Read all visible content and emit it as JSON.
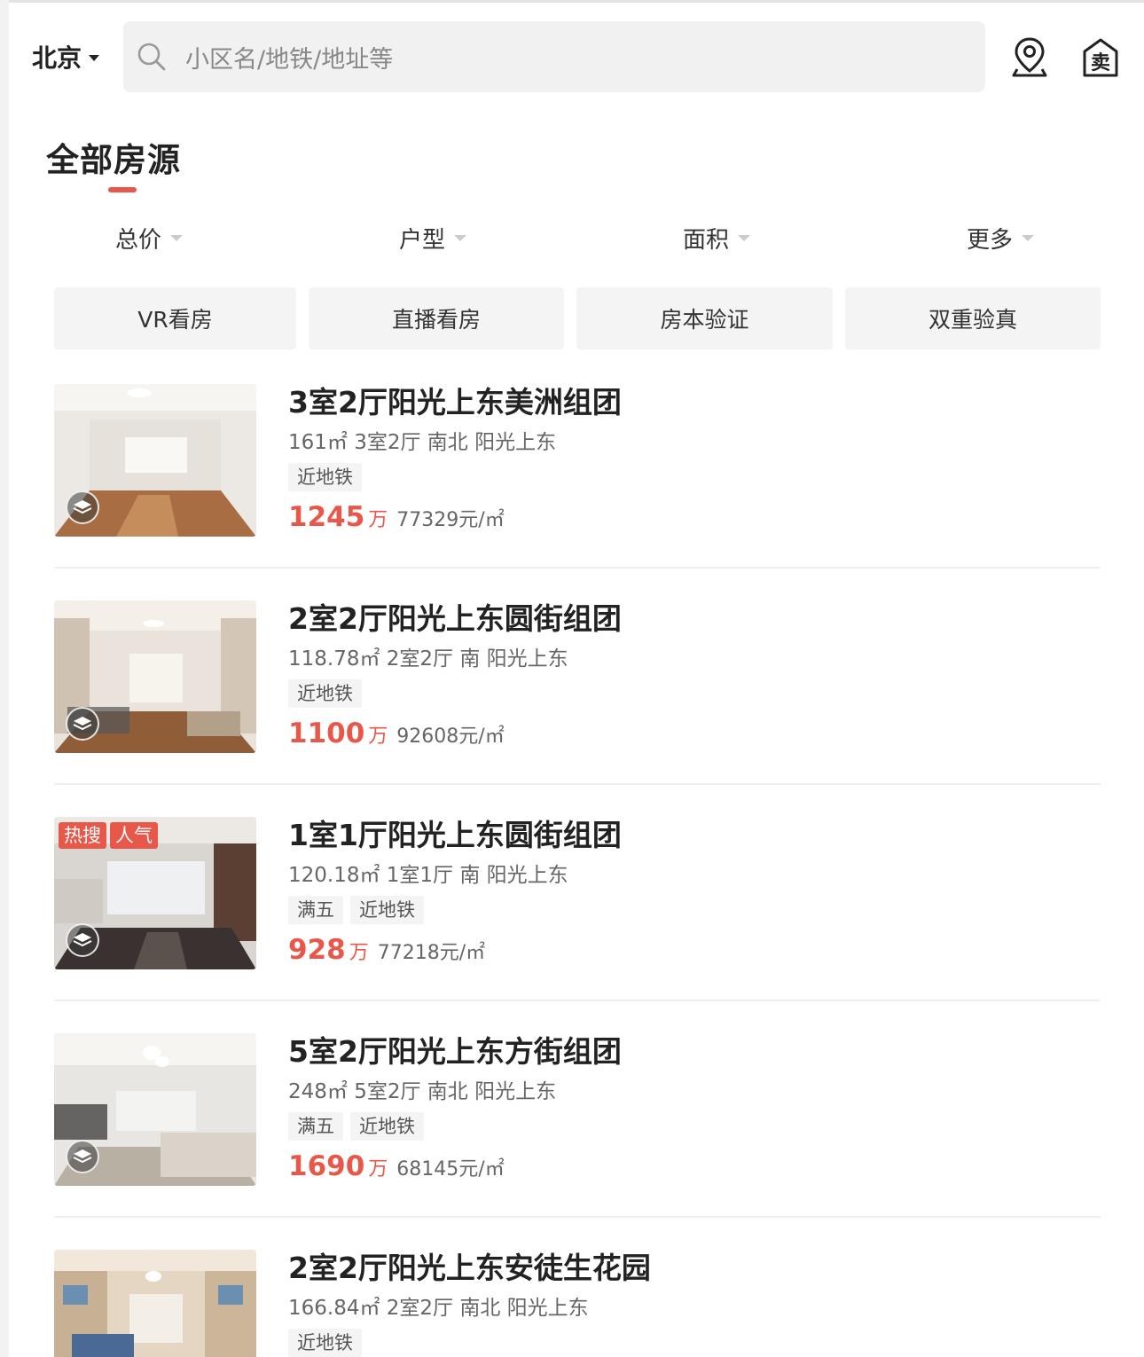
{
  "header": {
    "city": "北京",
    "search_placeholder": "小区名/地铁/地址等",
    "sell_label": "卖"
  },
  "section_title": "全部房源",
  "filters": [
    "总价",
    "户型",
    "面积",
    "更多"
  ],
  "quick_tags": [
    "VR看房",
    "直播看房",
    "房本验证",
    "双重验真"
  ],
  "price_unit": "万",
  "listings": [
    {
      "title": "3室2厅阳光上东美洲组团",
      "meta": "161㎡ 3室2厅 南北 阳光上东",
      "tags": [
        "近地铁"
      ],
      "hot_tags": [],
      "total": "1245",
      "per_sqm": "77329元/㎡"
    },
    {
      "title": "2室2厅阳光上东圆街组团",
      "meta": "118.78㎡ 2室2厅 南 阳光上东",
      "tags": [
        "近地铁"
      ],
      "hot_tags": [],
      "total": "1100",
      "per_sqm": "92608元/㎡"
    },
    {
      "title": "1室1厅阳光上东圆街组团",
      "meta": "120.18㎡ 1室1厅 南 阳光上东",
      "tags": [
        "满五",
        "近地铁"
      ],
      "hot_tags": [
        "热搜",
        "人气"
      ],
      "total": "928",
      "per_sqm": "77218元/㎡"
    },
    {
      "title": "5室2厅阳光上东方街组团",
      "meta": "248㎡ 5室2厅 南北 阳光上东",
      "tags": [
        "满五",
        "近地铁"
      ],
      "hot_tags": [],
      "total": "1690",
      "per_sqm": "68145元/㎡"
    },
    {
      "title": "2室2厅阳光上东安徒生花园",
      "meta": "166.84㎡ 2室2厅 南北 阳光上东",
      "tags": [
        "近地铁"
      ],
      "hot_tags": [],
      "total": "",
      "per_sqm": ""
    }
  ],
  "colors": {
    "accent": "#e8584a",
    "tag_bg": "#f4f4f4",
    "search_bg": "#f1f1f1"
  },
  "icons": [
    "search-icon",
    "map-pin-icon",
    "sell-house-icon",
    "vr-icon"
  ]
}
